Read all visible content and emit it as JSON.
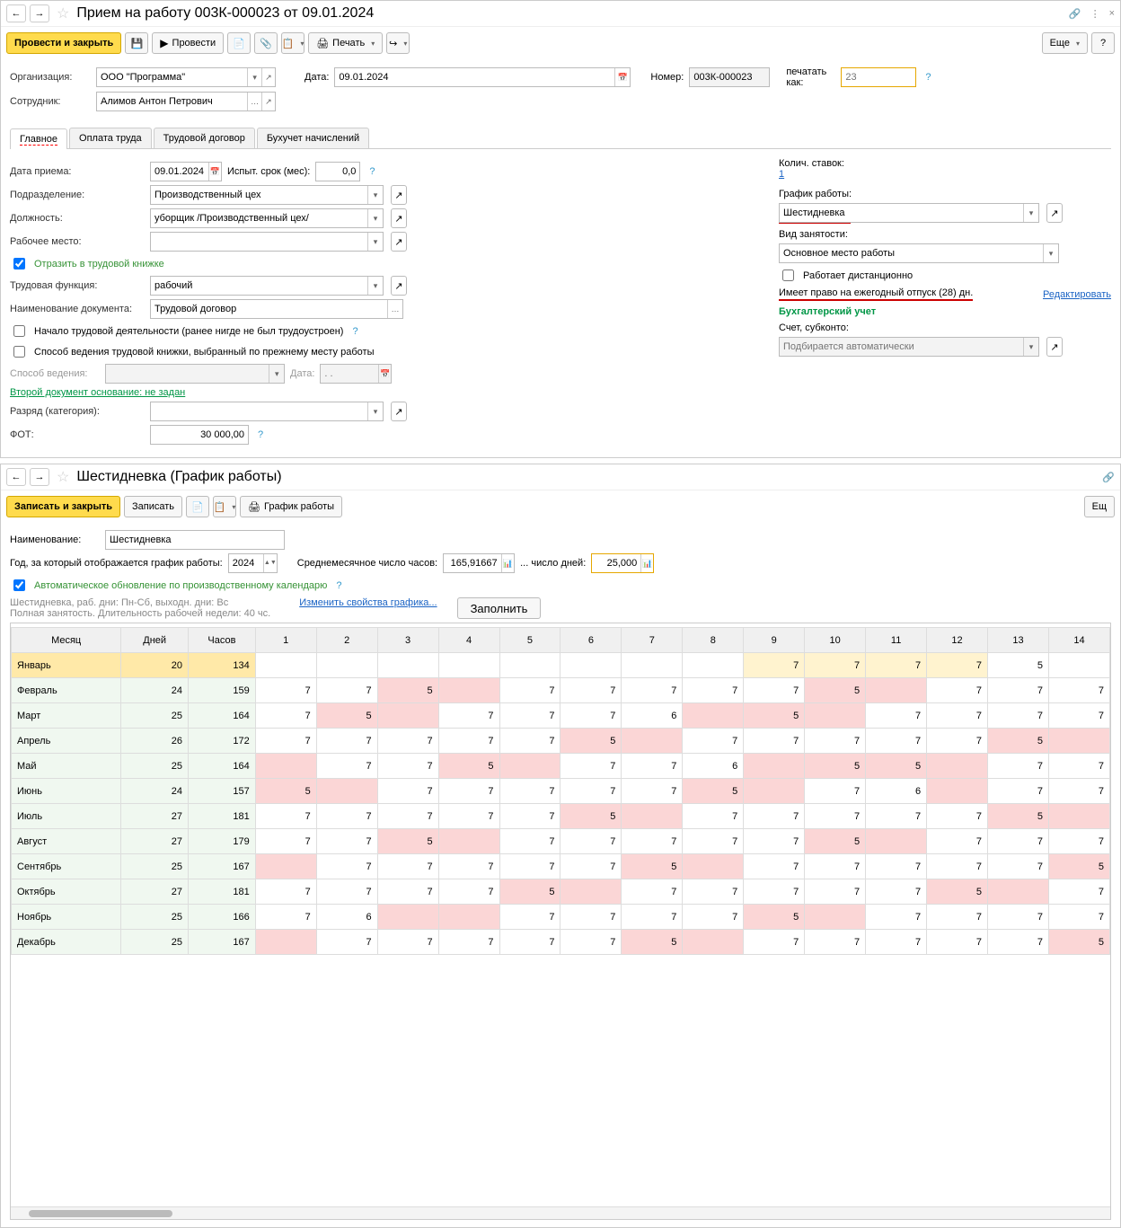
{
  "win1": {
    "title": "Прием на работу 003К-000023 от 09.01.2024",
    "toolbar": {
      "post_close": "Провести и закрыть",
      "post": "Провести",
      "print": "Печать",
      "more": "Еще"
    },
    "header": {
      "org_label": "Организация:",
      "org_value": "ООО \"Программа\"",
      "date_label": "Дата:",
      "date_value": "09.01.2024",
      "num_label": "Номер:",
      "num_value": "003К-000023",
      "printas_label": "печатать как:",
      "printas_ph": "23",
      "emp_label": "Сотрудник:",
      "emp_value": "Алимов Антон Петрович"
    },
    "tabs": [
      "Главное",
      "Оплата труда",
      "Трудовой договор",
      "Бухучет начислений"
    ],
    "left": {
      "hire_date_lbl": "Дата приема:",
      "hire_date": "09.01.2024",
      "trial_lbl": "Испыт. срок (мес):",
      "trial": "0,0",
      "dept_lbl": "Подразделение:",
      "dept": "Производственный цех",
      "pos_lbl": "Должность:",
      "pos": "уборщик /Производственный цех/",
      "place_lbl": "Рабочее место:",
      "book_chk": "Отразить в трудовой книжке",
      "func_lbl": "Трудовая функция:",
      "func": "рабочий",
      "docname_lbl": "Наименование документа:",
      "docname": "Трудовой договор",
      "first_chk": "Начало трудовой деятельности (ранее нигде не был трудоустроен)",
      "prev_chk": "Способ ведения трудовой книжки, выбранный по прежнему месту работы",
      "mode_lbl": "Способ ведения:",
      "date2_lbl": "Дата:",
      "date2_ph": ". .",
      "sec_doc_link": "Второй документ основание: не задан",
      "grade_lbl": "Разряд (категория):",
      "fot_lbl": "ФОТ:",
      "fot": "30 000,00"
    },
    "right": {
      "rates_lbl": "Колич. ставок:",
      "rates": "1",
      "sched_lbl": "График работы:",
      "sched": "Шестидневка",
      "emptype_lbl": "Вид занятости:",
      "emptype": "Основное место работы",
      "remote_chk": "Работает дистанционно",
      "leave_txt": "Имеет право на ежегодный отпуск (28) дн.",
      "edit_link": "Редактировать",
      "acc_title": "Бухгалтерский учет",
      "acc_lbl": "Счет, субконто:",
      "acc_ph": "Подбирается автоматически"
    }
  },
  "win2": {
    "title": "Шестидневка (График работы)",
    "toolbar": {
      "save_close": "Записать и закрыть",
      "save": "Записать",
      "sched_btn": "График работы",
      "more": "Ещ"
    },
    "name_lbl": "Наименование:",
    "name": "Шестидневка",
    "year_lbl": "Год, за который отображается график работы:",
    "year": "2024",
    "avg_hours_lbl": "Среднемесячное число часов:",
    "avg_hours": "165,91667",
    "avg_days_lbl": "... число дней:",
    "avg_days": "25,000",
    "auto_chk": "Автоматическое обновление по производственному календарю",
    "desc1": "Шестидневка, раб. дни: Пн-Сб, выходн. дни: Вс",
    "desc2": "Полная занятость. Длительность рабочей недели: 40 чс.",
    "edit_link": "Изменить свойства графика...",
    "fill_btn": "Заполнить",
    "headers": [
      "Месяц",
      "Дней",
      "Часов",
      "1",
      "2",
      "3",
      "4",
      "5",
      "6",
      "7",
      "8",
      "9",
      "10",
      "11",
      "12",
      "13",
      "14"
    ],
    "rows": [
      {
        "m": "Январь",
        "d": "20",
        "h": "134",
        "c": [
          [
            "",
            ""
          ],
          [
            "",
            ""
          ],
          [
            "",
            ""
          ],
          [
            "",
            ""
          ],
          [
            "",
            ""
          ],
          [
            "",
            ""
          ],
          [
            "",
            ""
          ],
          [
            "",
            ""
          ],
          [
            "7",
            "y"
          ],
          [
            "7",
            "y"
          ],
          [
            "7",
            "y"
          ],
          [
            "7",
            "y"
          ],
          [
            "5",
            "e"
          ],
          [
            "",
            ""
          ]
        ]
      },
      {
        "m": "Февраль",
        "d": "24",
        "h": "159",
        "c": [
          [
            "7",
            "w"
          ],
          [
            "7",
            "w"
          ],
          [
            "5",
            "p"
          ],
          [
            "",
            "p"
          ],
          [
            "7",
            "w"
          ],
          [
            "7",
            "w"
          ],
          [
            "7",
            "w"
          ],
          [
            "7",
            "w"
          ],
          [
            "7",
            "w"
          ],
          [
            "5",
            "p"
          ],
          [
            "",
            "p"
          ],
          [
            "7",
            "w"
          ],
          [
            "7",
            "w"
          ],
          [
            "7",
            "w"
          ]
        ]
      },
      {
        "m": "Март",
        "d": "25",
        "h": "164",
        "c": [
          [
            "7",
            "w"
          ],
          [
            "5",
            "p"
          ],
          [
            "",
            "p"
          ],
          [
            "7",
            "w"
          ],
          [
            "7",
            "w"
          ],
          [
            "7",
            "w"
          ],
          [
            "6",
            "w"
          ],
          [
            "",
            "p"
          ],
          [
            "5",
            "p"
          ],
          [
            "",
            "p"
          ],
          [
            "7",
            "w"
          ],
          [
            "7",
            "w"
          ],
          [
            "7",
            "w"
          ],
          [
            "7",
            "w"
          ]
        ]
      },
      {
        "m": "Апрель",
        "d": "26",
        "h": "172",
        "c": [
          [
            "7",
            "w"
          ],
          [
            "7",
            "w"
          ],
          [
            "7",
            "w"
          ],
          [
            "7",
            "w"
          ],
          [
            "7",
            "w"
          ],
          [
            "5",
            "p"
          ],
          [
            "",
            "p"
          ],
          [
            "7",
            "w"
          ],
          [
            "7",
            "w"
          ],
          [
            "7",
            "w"
          ],
          [
            "7",
            "w"
          ],
          [
            "7",
            "w"
          ],
          [
            "5",
            "p"
          ],
          [
            "",
            "p"
          ]
        ]
      },
      {
        "m": "Май",
        "d": "25",
        "h": "164",
        "c": [
          [
            "",
            "p"
          ],
          [
            "7",
            "w"
          ],
          [
            "7",
            "w"
          ],
          [
            "5",
            "p"
          ],
          [
            "",
            "p"
          ],
          [
            "7",
            "w"
          ],
          [
            "7",
            "w"
          ],
          [
            "6",
            "w"
          ],
          [
            "",
            "p"
          ],
          [
            "5",
            "p"
          ],
          [
            "5",
            "p"
          ],
          [
            "",
            "p"
          ],
          [
            "7",
            "w"
          ],
          [
            "7",
            "w"
          ]
        ]
      },
      {
        "m": "Июнь",
        "d": "24",
        "h": "157",
        "c": [
          [
            "5",
            "p"
          ],
          [
            "",
            "p"
          ],
          [
            "7",
            "w"
          ],
          [
            "7",
            "w"
          ],
          [
            "7",
            "w"
          ],
          [
            "7",
            "w"
          ],
          [
            "7",
            "w"
          ],
          [
            "5",
            "p"
          ],
          [
            "",
            "p"
          ],
          [
            "7",
            "w"
          ],
          [
            "6",
            "w"
          ],
          [
            "",
            "p"
          ],
          [
            "7",
            "w"
          ],
          [
            "7",
            "w"
          ]
        ]
      },
      {
        "m": "Июль",
        "d": "27",
        "h": "181",
        "c": [
          [
            "7",
            "w"
          ],
          [
            "7",
            "w"
          ],
          [
            "7",
            "w"
          ],
          [
            "7",
            "w"
          ],
          [
            "7",
            "w"
          ],
          [
            "5",
            "p"
          ],
          [
            "",
            "p"
          ],
          [
            "7",
            "w"
          ],
          [
            "7",
            "w"
          ],
          [
            "7",
            "w"
          ],
          [
            "7",
            "w"
          ],
          [
            "7",
            "w"
          ],
          [
            "5",
            "p"
          ],
          [
            "",
            "p"
          ]
        ]
      },
      {
        "m": "Август",
        "d": "27",
        "h": "179",
        "c": [
          [
            "7",
            "w"
          ],
          [
            "7",
            "w"
          ],
          [
            "5",
            "p"
          ],
          [
            "",
            "p"
          ],
          [
            "7",
            "w"
          ],
          [
            "7",
            "w"
          ],
          [
            "7",
            "w"
          ],
          [
            "7",
            "w"
          ],
          [
            "7",
            "w"
          ],
          [
            "5",
            "p"
          ],
          [
            "",
            "p"
          ],
          [
            "7",
            "w"
          ],
          [
            "7",
            "w"
          ],
          [
            "7",
            "w"
          ]
        ]
      },
      {
        "m": "Сентябрь",
        "d": "25",
        "h": "167",
        "c": [
          [
            "",
            "p"
          ],
          [
            "7",
            "w"
          ],
          [
            "7",
            "w"
          ],
          [
            "7",
            "w"
          ],
          [
            "7",
            "w"
          ],
          [
            "7",
            "w"
          ],
          [
            "5",
            "p"
          ],
          [
            "",
            "p"
          ],
          [
            "7",
            "w"
          ],
          [
            "7",
            "w"
          ],
          [
            "7",
            "w"
          ],
          [
            "7",
            "w"
          ],
          [
            "7",
            "w"
          ],
          [
            "5",
            "p"
          ]
        ]
      },
      {
        "m": "Октябрь",
        "d": "27",
        "h": "181",
        "c": [
          [
            "7",
            "w"
          ],
          [
            "7",
            "w"
          ],
          [
            "7",
            "w"
          ],
          [
            "7",
            "w"
          ],
          [
            "5",
            "p"
          ],
          [
            "",
            "p"
          ],
          [
            "7",
            "w"
          ],
          [
            "7",
            "w"
          ],
          [
            "7",
            "w"
          ],
          [
            "7",
            "w"
          ],
          [
            "7",
            "w"
          ],
          [
            "5",
            "p"
          ],
          [
            "",
            "p"
          ],
          [
            "7",
            "w"
          ]
        ]
      },
      {
        "m": "Ноябрь",
        "d": "25",
        "h": "166",
        "c": [
          [
            "7",
            "w"
          ],
          [
            "6",
            "w"
          ],
          [
            "",
            "p"
          ],
          [
            "",
            "p"
          ],
          [
            "7",
            "w"
          ],
          [
            "7",
            "w"
          ],
          [
            "7",
            "w"
          ],
          [
            "7",
            "w"
          ],
          [
            "5",
            "p"
          ],
          [
            "",
            "p"
          ],
          [
            "7",
            "w"
          ],
          [
            "7",
            "w"
          ],
          [
            "7",
            "w"
          ],
          [
            "7",
            "w"
          ]
        ]
      },
      {
        "m": "Декабрь",
        "d": "25",
        "h": "167",
        "c": [
          [
            "",
            "p"
          ],
          [
            "7",
            "w"
          ],
          [
            "7",
            "w"
          ],
          [
            "7",
            "w"
          ],
          [
            "7",
            "w"
          ],
          [
            "7",
            "w"
          ],
          [
            "5",
            "p"
          ],
          [
            "",
            "p"
          ],
          [
            "7",
            "w"
          ],
          [
            "7",
            "w"
          ],
          [
            "7",
            "w"
          ],
          [
            "7",
            "w"
          ],
          [
            "7",
            "w"
          ],
          [
            "5",
            "p"
          ]
        ]
      }
    ]
  }
}
